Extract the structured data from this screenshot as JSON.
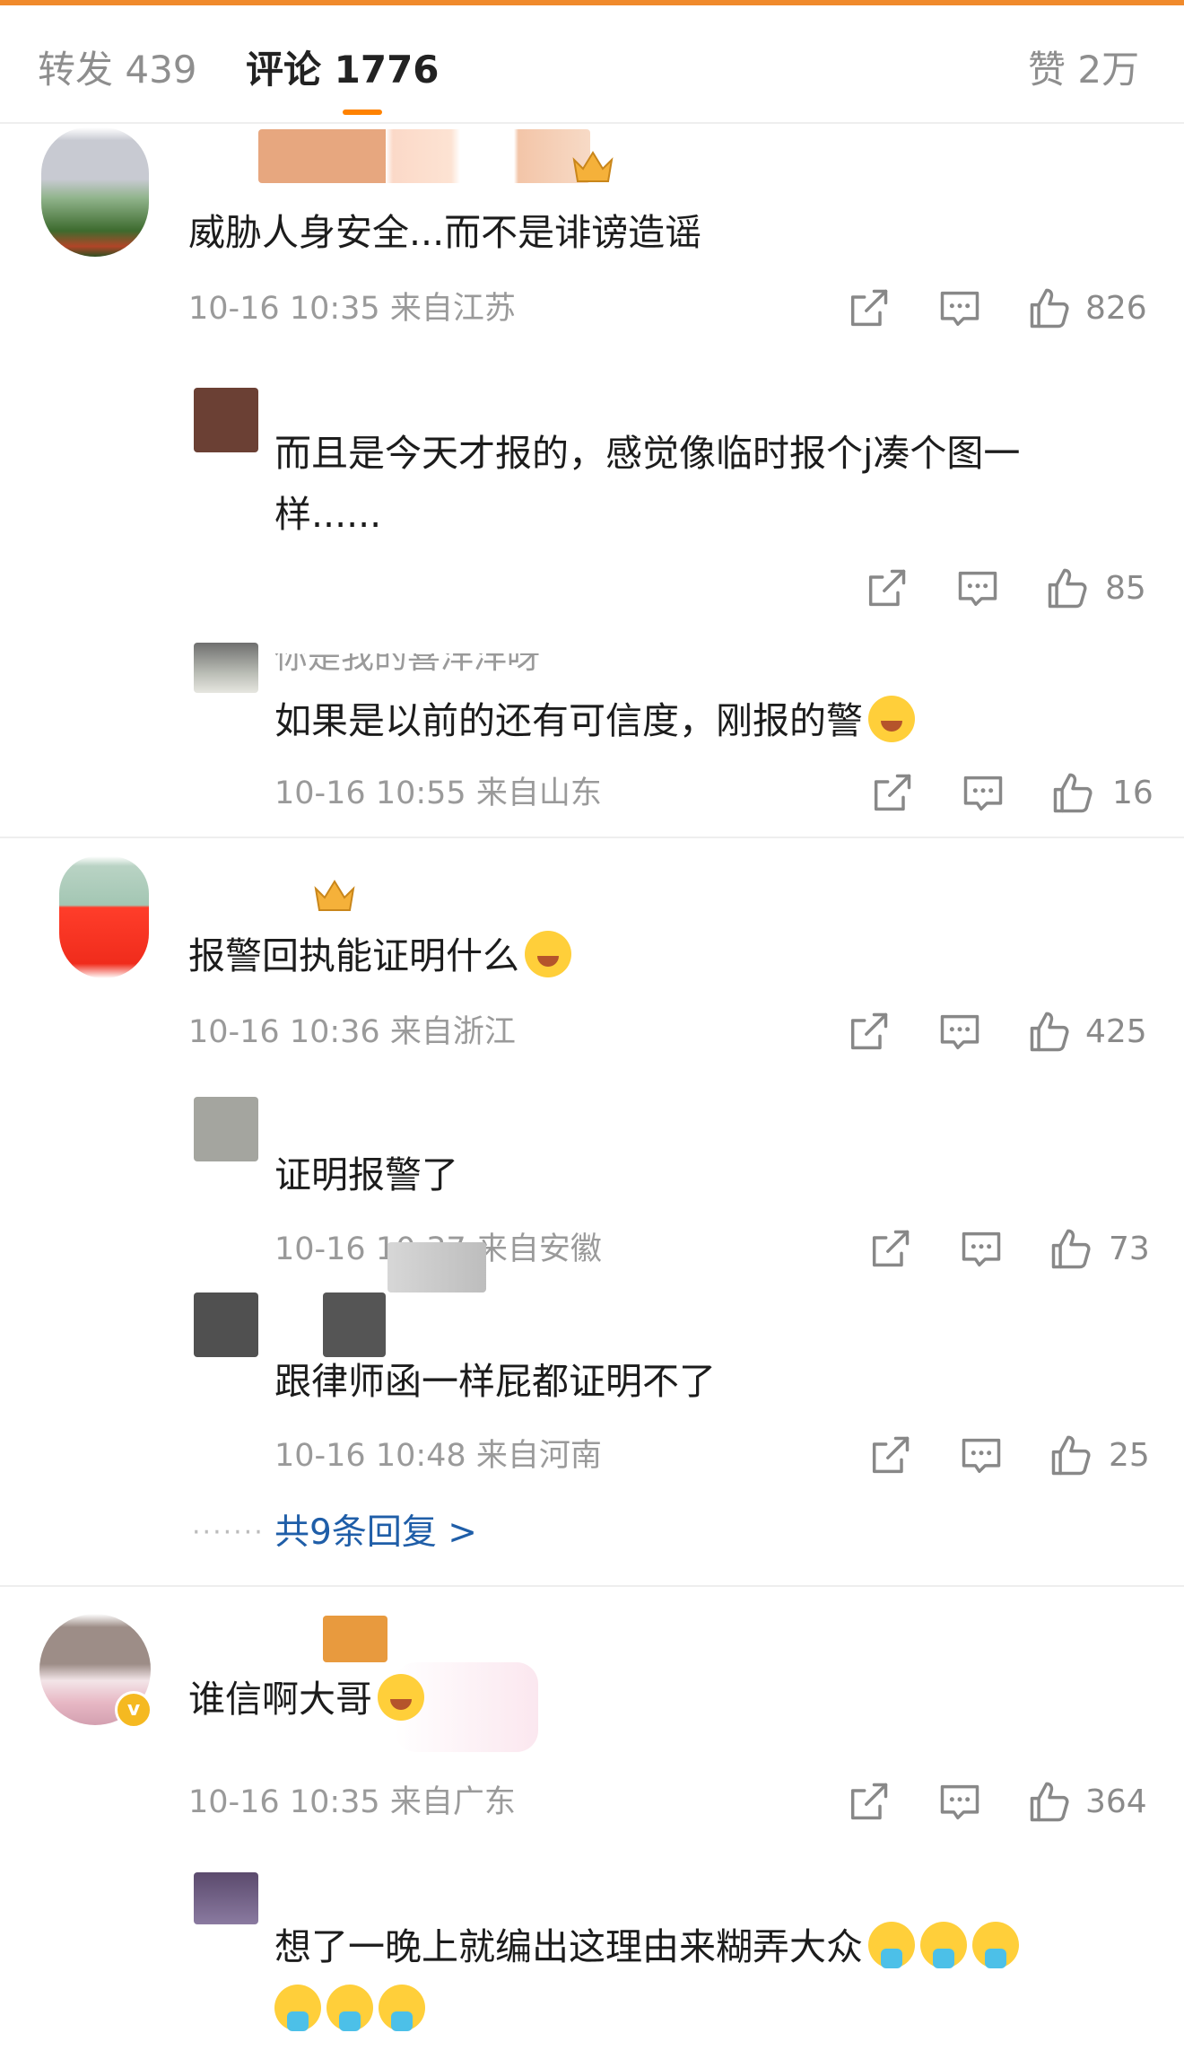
{
  "tabs": {
    "repost_label": "转发 439",
    "comment_label": "评论 1776",
    "like_label": "赞 2万"
  },
  "comments": [
    {
      "text": "威胁人身安全...而不是诽谤造谣",
      "meta": "10-16 10:35  来自江苏",
      "likes": "826",
      "replies": [
        {
          "text1": "而且是今天才报的，感觉像临时报个j凑个图一",
          "text2": "样......",
          "likes": "85"
        },
        {
          "name": "你是我的喜洋洋呀",
          "text": "如果是以前的还有可信度，刚报的警",
          "meta": "10-16 10:55  来自山东",
          "likes": "16"
        }
      ]
    },
    {
      "text": "报警回执能证明什么",
      "meta": "10-16 10:36  来自浙江",
      "likes": "425",
      "replies": [
        {
          "text": "证明报警了",
          "meta": "10-16 10:37  来自安徽",
          "likes": "73"
        },
        {
          "text": "跟律师函一样屁都证明不了",
          "meta": "10-16 10:48  来自河南",
          "likes": "25"
        }
      ],
      "more_replies": "共9条回复 >",
      "dots": "·······"
    },
    {
      "text": "谁信啊大哥",
      "meta": "10-16 10:35  来自广东",
      "likes": "364",
      "verified": "v",
      "replies": [
        {
          "text": "想了一晚上就编出这理由来糊弄大众"
        }
      ]
    }
  ],
  "icons": {
    "share": "share-icon",
    "comment": "comment-icon",
    "like": "thumbs-up-icon",
    "emoji_laugh": "laugh-cry-emoji",
    "emoji_cry": "crying-emoji",
    "emoji_shy": "shy-emoji",
    "emoji_vomit": "vomit-emoji"
  },
  "colors": {
    "accent": "#ff8200",
    "link": "#1f5ea8",
    "meta": "#9a9a9a"
  }
}
